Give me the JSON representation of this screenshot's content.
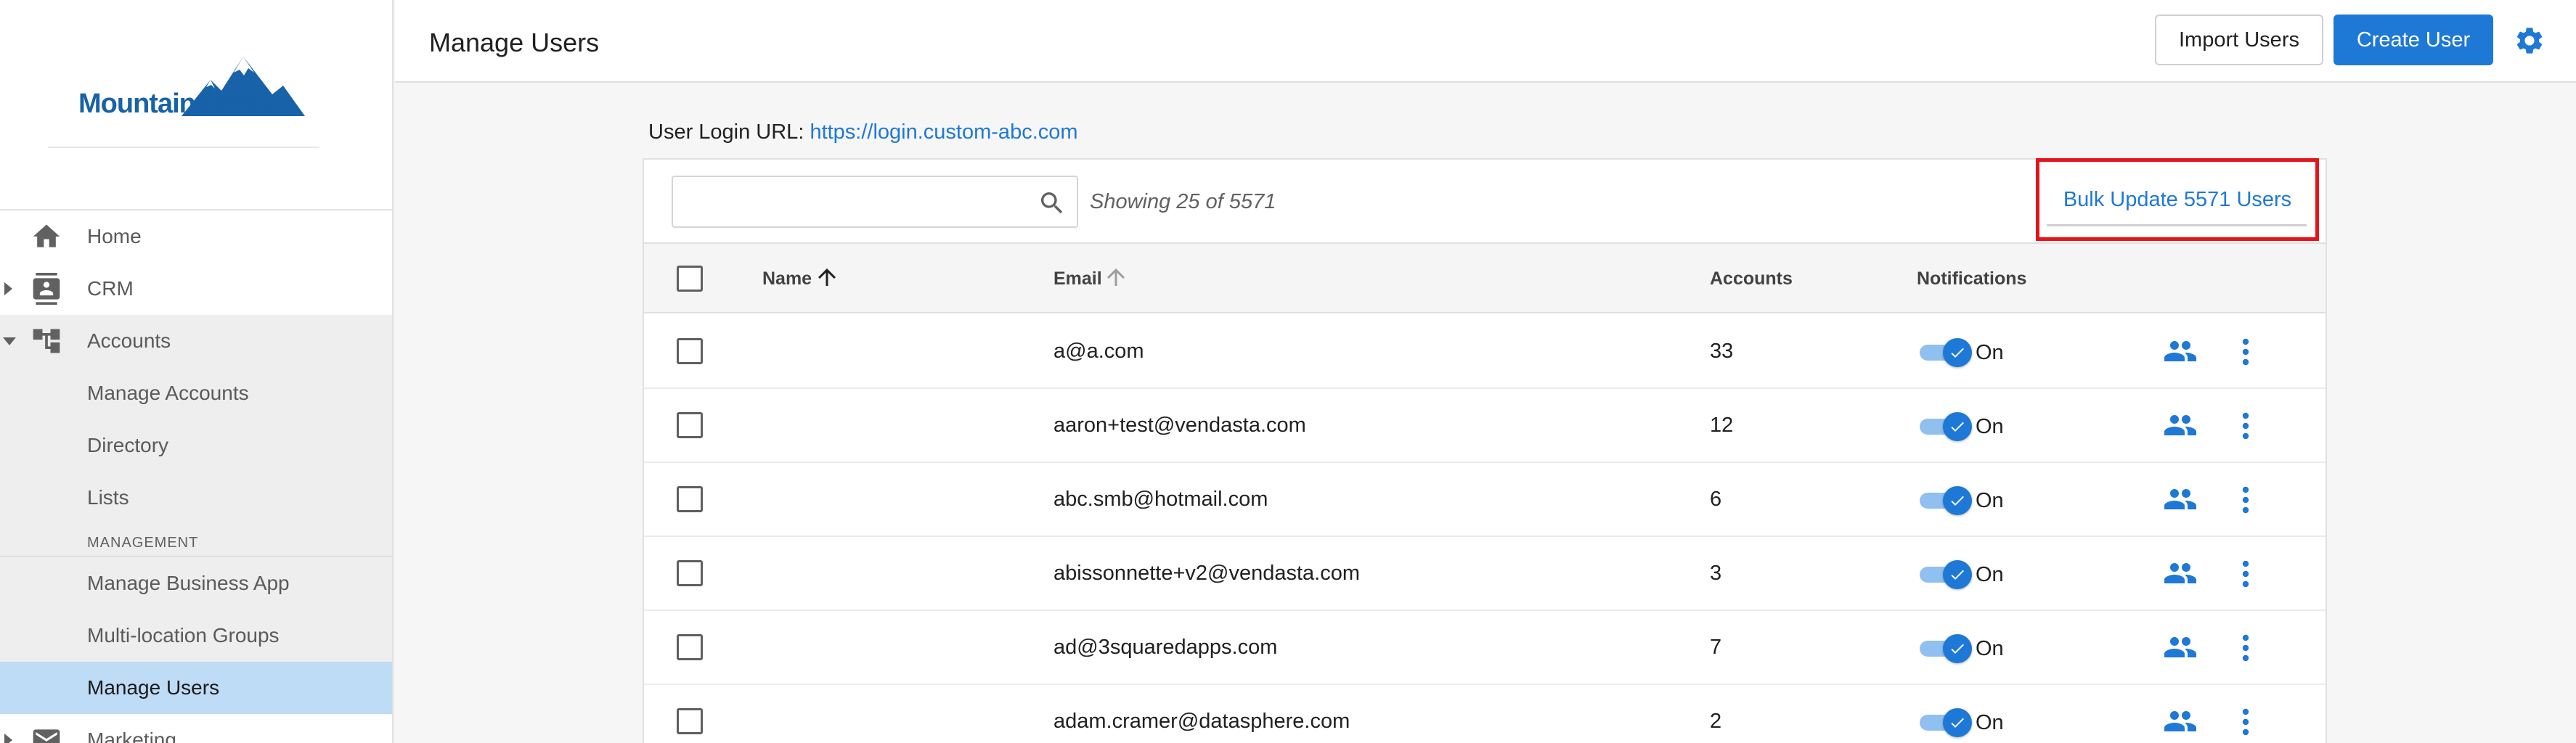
{
  "brand": {
    "name": "Mountain Media",
    "color": "#1762a8"
  },
  "sidebar": {
    "items": [
      {
        "label": "Home",
        "icon": "home-icon",
        "expanded": null
      },
      {
        "label": "CRM",
        "icon": "contacts-icon",
        "expanded": false
      },
      {
        "label": "Accounts",
        "icon": "hierarchy-icon",
        "expanded": true,
        "children": [
          "Manage Accounts",
          "Directory",
          "Lists"
        ],
        "section": "MANAGEMENT",
        "section_children": [
          "Manage Business App",
          "Multi-location Groups",
          "Manage Users"
        ]
      },
      {
        "label": "Marketing",
        "icon": "mail-icon",
        "expanded": false
      }
    ],
    "active": "Manage Users"
  },
  "header": {
    "title": "Manage Users",
    "import_label": "Import Users",
    "create_label": "Create User",
    "accent": "#1e78d6"
  },
  "main": {
    "login_prefix": "User Login URL:",
    "login_url": "https://login.custom-abc.com",
    "search": {
      "value": "",
      "placeholder": ""
    },
    "showing": "Showing 25 of 5571",
    "bulk_label": "Bulk Update 5571 Users",
    "highlight_color": "#e5141b",
    "columns": {
      "name": "Name",
      "email": "Email",
      "accounts": "Accounts",
      "notifications": "Notifications"
    },
    "rows": [
      {
        "name": "",
        "email": "a@a.com",
        "accounts": "33",
        "notifications": "On"
      },
      {
        "name": "",
        "email": "aaron+test@vendasta.com",
        "accounts": "12",
        "notifications": "On"
      },
      {
        "name": "",
        "email": "abc.smb@hotmail.com",
        "accounts": "6",
        "notifications": "On"
      },
      {
        "name": "",
        "email": "abissonnette+v2@vendasta.com",
        "accounts": "3",
        "notifications": "On"
      },
      {
        "name": "",
        "email": "ad@3squaredapps.com",
        "accounts": "7",
        "notifications": "On"
      },
      {
        "name": "",
        "email": "adam.cramer@datasphere.com",
        "accounts": "2",
        "notifications": "On"
      }
    ]
  }
}
